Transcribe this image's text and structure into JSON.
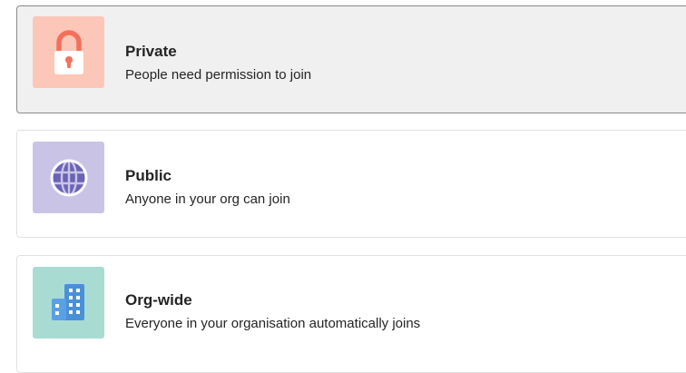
{
  "team_privacy_options": [
    {
      "title": "Private",
      "description": "People need permission to join",
      "icon": "lock-icon",
      "tile_color": "#fcc6b8",
      "icon_color": "#f4705a",
      "selected": true
    },
    {
      "title": "Public",
      "description": "Anyone in your org can join",
      "icon": "globe-icon",
      "tile_color": "#c9c4e6",
      "icon_color": "#6b63b5",
      "selected": false
    },
    {
      "title": "Org-wide",
      "description": "Everyone in your organisation automatically joins",
      "icon": "building-icon",
      "tile_color": "#a8dcd2",
      "icon_color": "#4a90d9",
      "selected": false
    }
  ]
}
